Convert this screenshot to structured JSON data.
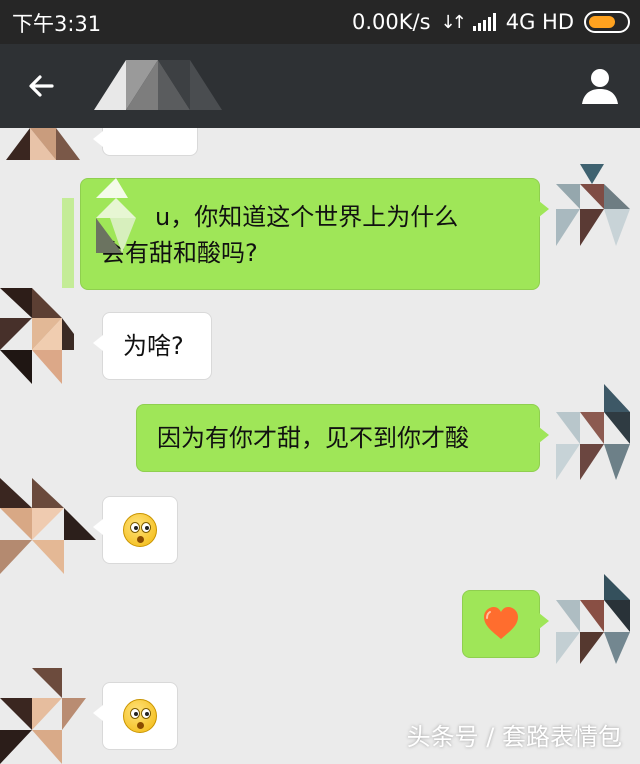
{
  "status_bar": {
    "time": "下午3:31",
    "network_speed": "0.00K/s",
    "network_type": "4G HD",
    "battery_color": "#ffa21f"
  },
  "title_bar": {
    "back_icon": "arrow-left-icon",
    "contact_name": "",
    "profile_icon": "person-icon"
  },
  "messages": [
    {
      "side": "in",
      "type": "text",
      "text": ""
    },
    {
      "side": "out",
      "type": "text",
      "text_line1": "u，你知道这个世界上为什么",
      "text_line2": "会有甜和酸吗?"
    },
    {
      "side": "in",
      "type": "text",
      "text": "为啥?"
    },
    {
      "side": "out",
      "type": "text",
      "text": "因为有你才甜，见不到你才酸"
    },
    {
      "side": "in",
      "type": "emoji",
      "emoji": "surprised-face-emoji"
    },
    {
      "side": "out",
      "type": "emoji",
      "emoji": "heart-emoji"
    },
    {
      "side": "in",
      "type": "emoji",
      "emoji": "surprised-face-emoji"
    }
  ],
  "colors": {
    "chat_background": "#ebebeb",
    "outgoing_bubble": "#9fe658",
    "incoming_bubble": "#ffffff",
    "title_bar": "#2e3134",
    "status_bar": "#262626"
  },
  "watermark": "头条号 / 套路表情包"
}
